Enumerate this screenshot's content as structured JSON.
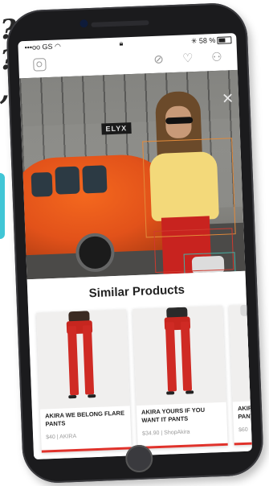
{
  "background": {
    "glyphs": [
      "?",
      "?",
      ","
    ],
    "accent_color": "#41c6d6"
  },
  "status_bar": {
    "carrier": "•••oo GS",
    "wifi_icon": "wifi-icon",
    "lock_icon": "lock-icon",
    "battery_text": "58 %",
    "bluetooth_icon": "bluetooth-icon"
  },
  "app_bar": {
    "left_icon": "instagram-icon",
    "right_icons": [
      "compass-icon",
      "heart-icon",
      "profile-icon"
    ]
  },
  "photo": {
    "sign_text": "ELYX",
    "close_icon": "close-icon",
    "detection_colors": {
      "top": "#e28a3a",
      "pants": "#d03a2f",
      "bag": "#46b1a4"
    }
  },
  "similar_products": {
    "title": "Similar Products",
    "items": [
      {
        "name": "AKIRA WE BELONG FLARE PANTS",
        "price": "$40",
        "store": "AKIRA",
        "torso_color": "#3a2a22"
      },
      {
        "name": "AKIRA YOURS IF YOU WANT IT PANTS",
        "price": "$34.90",
        "store": "ShopAkira",
        "torso_color": "#2a2a2a"
      },
      {
        "name": "AKIR PANTS",
        "price": "$60",
        "store": "",
        "torso_color": "#d8d8d8"
      }
    ]
  },
  "accent_color": "#e0322b"
}
